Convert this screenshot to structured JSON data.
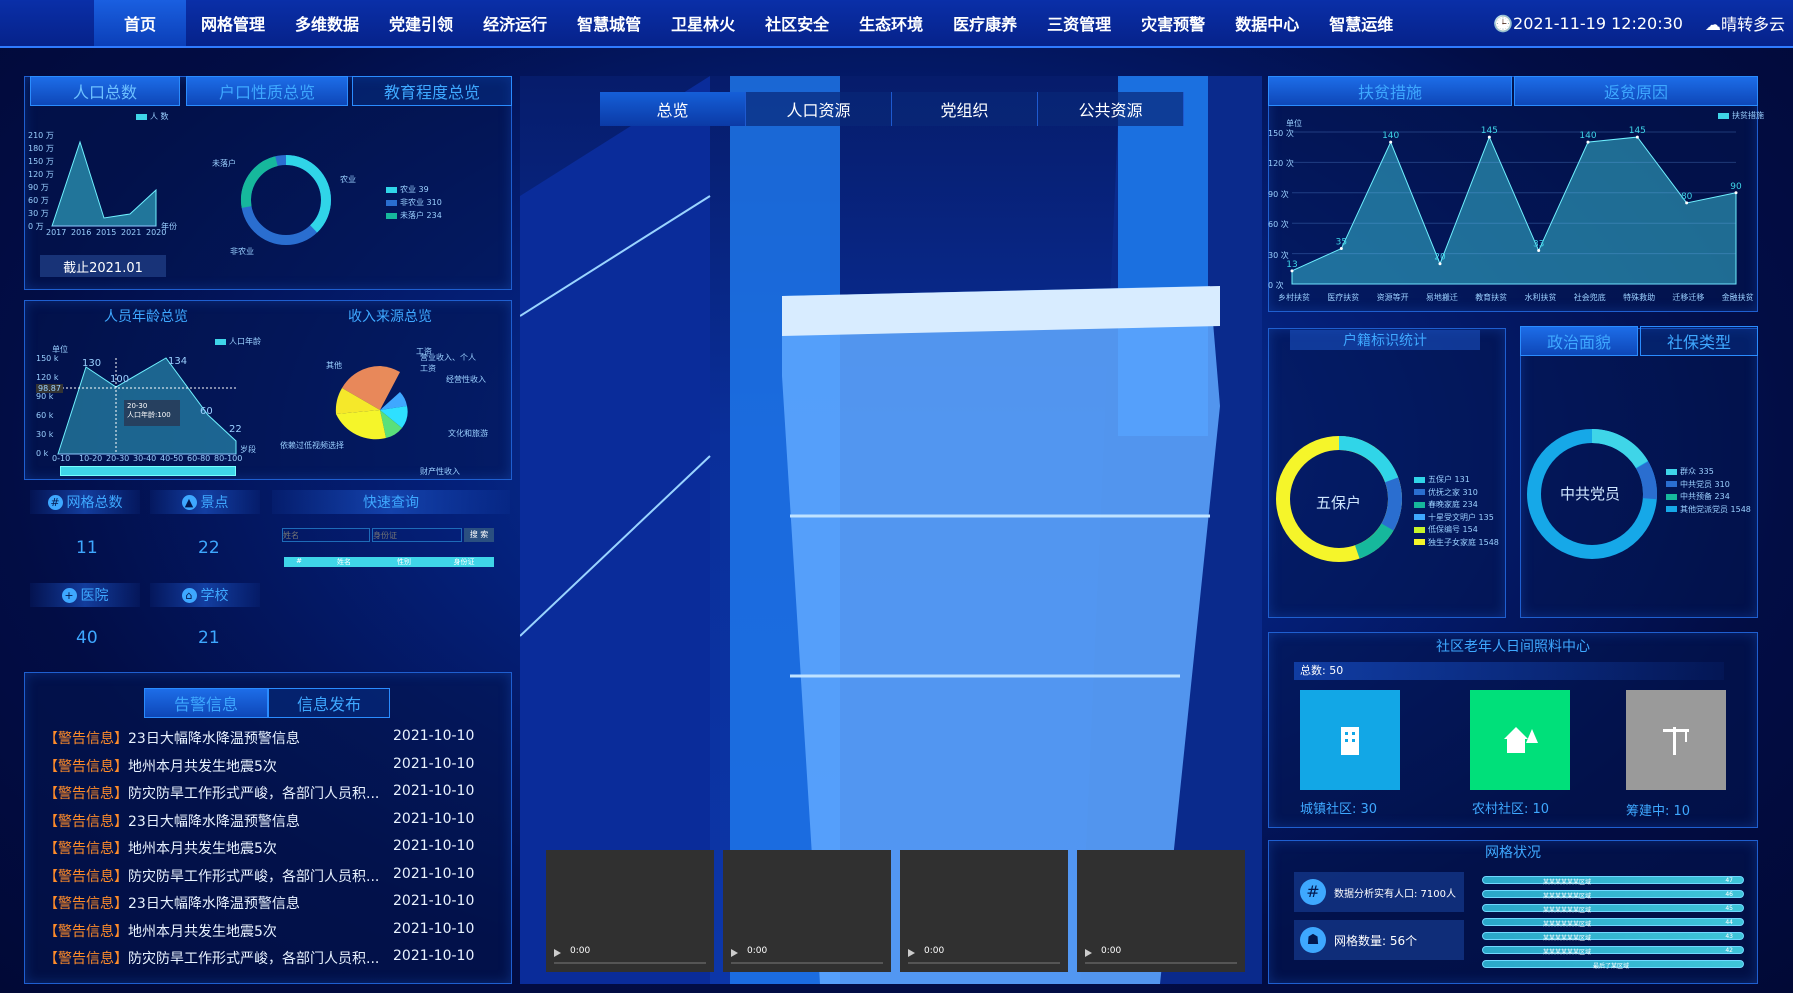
{
  "nav": {
    "items": [
      "首页",
      "网格管理",
      "多维数据",
      "党建引领",
      "经济运行",
      "智慧城管",
      "卫星林火",
      "社区安全",
      "生态环境",
      "医疗康养",
      "三资管理",
      "灾害预警",
      "数据中心",
      "智慧运维"
    ],
    "datetime": "2021-11-19 12:20:30",
    "weather": "晴转多云"
  },
  "left": {
    "tabs": {
      "population": "人口总数",
      "household": "户口性质总览",
      "education": "教育程度总览"
    },
    "popchart": {
      "legend": "人 数",
      "unit": "",
      "ticks": [
        "210 万",
        "180 万",
        "150 万",
        "120 万",
        "90 万",
        "60 万",
        "30 万",
        "0 万"
      ],
      "xticks": [
        "2017",
        "2016",
        "2015",
        "2021",
        "2020"
      ],
      "xunit": "年份",
      "note": "截止2021.01"
    },
    "household": {
      "labels": [
        "未落户",
        "农业",
        "非农业"
      ],
      "legend": [
        "农业 39",
        "非农业 310",
        "未落户 234"
      ]
    },
    "age_title": "人员年龄总览",
    "income_title": "收入来源总览",
    "agechart": {
      "unit": "单位",
      "legend": "人口年龄",
      "yticks": [
        "150 k",
        "120 k",
        "90 k",
        "60 k",
        "30 k",
        "0 k"
      ],
      "xticks": [
        "0-10",
        "10-20",
        "20-30",
        "30-40",
        "40-50",
        "60-80",
        "80-100"
      ],
      "xunit": "岁段",
      "labels": [
        "130",
        "100",
        "134",
        "60",
        "22"
      ],
      "marker": "98.87",
      "tip": "20-30",
      "tip2": "人口年龄:100"
    },
    "income": {
      "labels": [
        "其他",
        "营业收入、个人工资",
        "经营性收入",
        "工资",
        "文化和旅游",
        "依赖过低视频选择",
        "财产性收入"
      ]
    },
    "stats": [
      {
        "label": "网格总数",
        "value": "11"
      },
      {
        "label": "景点",
        "value": "22"
      },
      {
        "label": "医院",
        "value": "40"
      },
      {
        "label": "学校",
        "value": "21"
      }
    ],
    "query": {
      "title": "快速查询",
      "name_ph": "姓名",
      "id_ph": "身份证",
      "btn": "搜 索",
      "cols": [
        "#",
        "姓名",
        "性别",
        "身份证"
      ]
    },
    "alert_tabs": [
      "告警信息",
      "信息发布"
    ],
    "alerts": [
      {
        "tag": "【警告信息】",
        "text": "23日大幅降水降温预警信息",
        "date": "2021-10-10"
      },
      {
        "tag": "【警告信息】",
        "text": "地州本月共发生地震5次",
        "date": "2021-10-10"
      },
      {
        "tag": "【警告信息】",
        "text": "防灾防旱工作形式严峻，各部门人员积...",
        "date": "2021-10-10"
      },
      {
        "tag": "【警告信息】",
        "text": "23日大幅降水降温预警信息",
        "date": "2021-10-10"
      },
      {
        "tag": "【警告信息】",
        "text": "地州本月共发生地震5次",
        "date": "2021-10-10"
      },
      {
        "tag": "【警告信息】",
        "text": "防灾防旱工作形式严峻，各部门人员积...",
        "date": "2021-10-10"
      },
      {
        "tag": "【警告信息】",
        "text": "23日大幅降水降温预警信息",
        "date": "2021-10-10"
      },
      {
        "tag": "【警告信息】",
        "text": "地州本月共发生地震5次",
        "date": "2021-10-10"
      },
      {
        "tag": "【警告信息】",
        "text": "防灾防旱工作形式严峻，各部门人员积...",
        "date": "2021-10-10"
      }
    ]
  },
  "center": {
    "tabs": [
      "总览",
      "人口资源",
      "党组织",
      "公共资源"
    ],
    "videos": [
      "0:00",
      "0:00",
      "0:00",
      "0:00"
    ]
  },
  "right": {
    "tabs": {
      "poverty": "扶贫措施",
      "return": "返贫原因"
    },
    "areachart": {
      "unit": "单位",
      "legend": "扶贫措施",
      "yticks": [
        "150 次",
        "120 次",
        "90 次",
        "60 次",
        "30 次",
        "0 次"
      ],
      "categories": [
        "乡村扶贫",
        "医疗扶贫",
        "资源等开",
        "易地搬迁",
        "教育扶贫",
        "水利扶贫",
        "社会兜底",
        "特殊救助",
        "迁移迁移",
        "金融扶贫"
      ],
      "values": [
        13,
        35,
        140,
        20,
        145,
        33,
        140,
        145,
        80,
        90
      ],
      "labels": [
        "13",
        "35",
        "140",
        "20",
        "145",
        "33",
        "140",
        "145",
        "80",
        "90"
      ]
    },
    "hukou": {
      "title": "户籍标识统计",
      "center": "五保户",
      "legend": [
        "五保户 131",
        "优抚之家 310",
        "春晚家庭 234",
        "十星受文明户 135",
        "低保编号 154",
        "独生子女家庭 1548"
      ]
    },
    "pol_tabs": {
      "face": "政治面貌",
      "social": "社保类型"
    },
    "party": {
      "center": "中共党员",
      "legend": [
        "群众 335",
        "中共党员 310",
        "中共预备 234",
        "其他党派党员 1548"
      ]
    },
    "elder": {
      "title": "社区老年人日间照料中心",
      "total": "总数: 50",
      "boxes": [
        "城镇社区: 30",
        "农村社区: 10",
        "筹建中: 10"
      ]
    },
    "grid": {
      "title": "网格状况",
      "pop": "数据分析实有人口: 7100人",
      "count": "网格数量: 56个",
      "bars": [
        "47",
        "46",
        "45",
        "44",
        "43",
        "42"
      ],
      "barlabel": "某某某某某某区域",
      "lastlabel": "最后了某区域"
    }
  },
  "chart_data": {
    "type": "area",
    "title": "",
    "categories": [
      "乡村扶贫",
      "医疗扶贫",
      "资源等开",
      "易地搬迁",
      "教育扶贫",
      "水利扶贫",
      "社会兜底",
      "特殊救助",
      "迁移迁移",
      "金融扶贫"
    ],
    "series": [
      {
        "name": "扶贫措施",
        "values": [
          13,
          35,
          140,
          20,
          145,
          33,
          140,
          145,
          80,
          90
        ]
      }
    ],
    "ylim": [
      0,
      150
    ]
  },
  "colors": {
    "accent": "#3ea8ff",
    "alert": "#ff8c2a",
    "green": "#00e07a",
    "blue_box": "#12a7e6",
    "gray_box": "#9a9a9a"
  }
}
